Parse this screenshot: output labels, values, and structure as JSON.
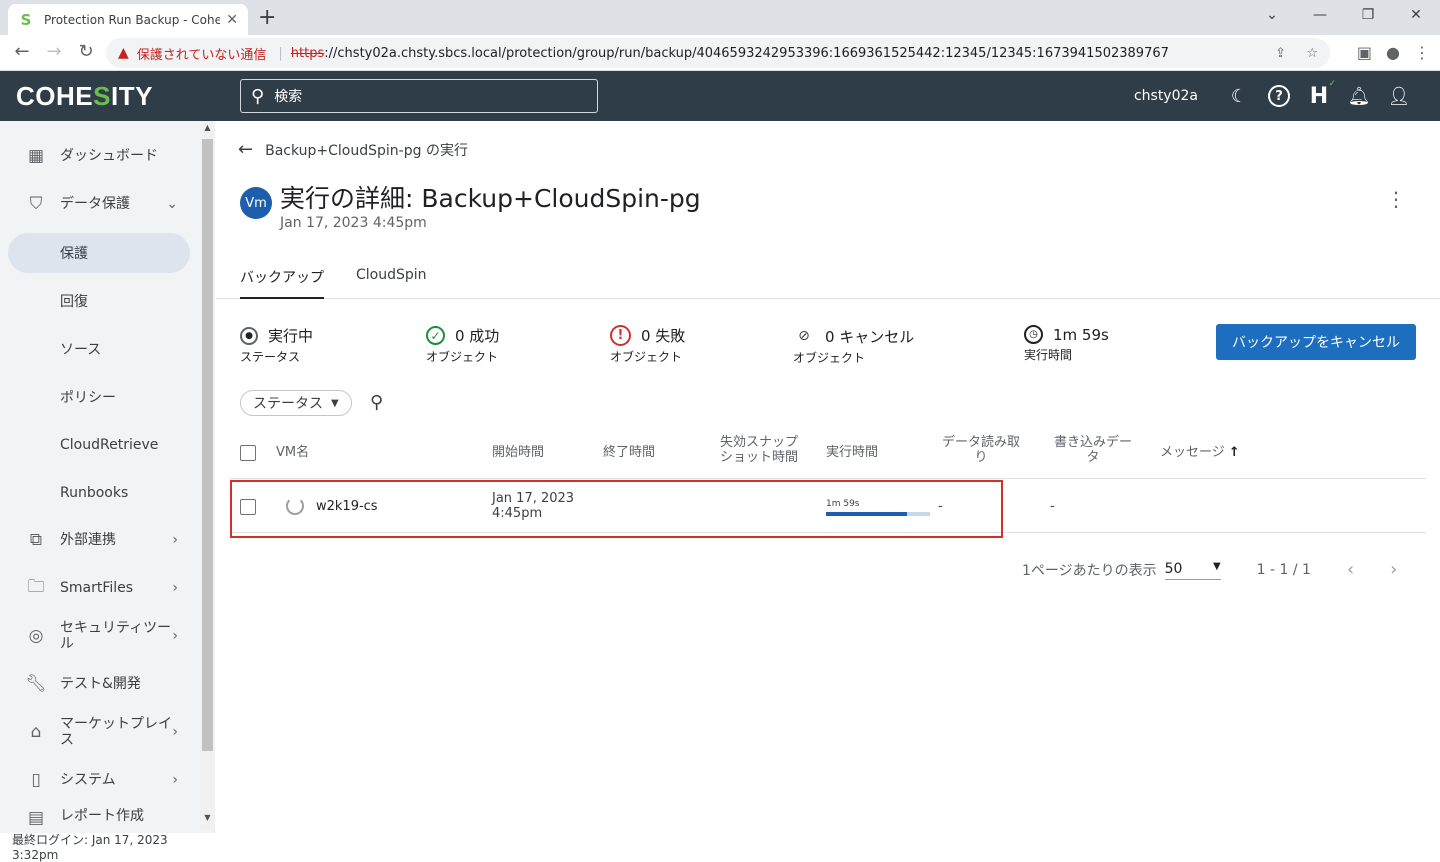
{
  "browser": {
    "tab_title": "Protection Run Backup - Cohesity",
    "new_tab": "+",
    "insecure_label": "保護されていない通信",
    "url_scheme": "https",
    "url_rest": "://chsty02a.chsty.sbcs.local/protection/group/run/backup/4046593242953396:1669361525442:12345/12345:1673941502389767"
  },
  "header": {
    "logo_left": "COHE",
    "logo_i": "S",
    "logo_right": "ITY",
    "search_placeholder": "検索",
    "user": "chsty02a"
  },
  "sidebar": {
    "items": [
      {
        "label": "ダッシュボード"
      },
      {
        "label": "データ保護"
      },
      {
        "label": "保護"
      },
      {
        "label": "回復"
      },
      {
        "label": "ソース"
      },
      {
        "label": "ポリシー"
      },
      {
        "label": "CloudRetrieve"
      },
      {
        "label": "Runbooks"
      },
      {
        "label": "外部連携"
      },
      {
        "label": "SmartFiles"
      },
      {
        "label": "セキュリティツール"
      },
      {
        "label": "テスト&開発"
      },
      {
        "label": "マーケットプレイス"
      },
      {
        "label": "システム"
      },
      {
        "label": "レポート作成"
      }
    ],
    "last_login": "最終ログイン: Jan 17, 2023 3:32pm"
  },
  "page": {
    "breadcrumb": "Backup+CloudSpin-pg の実行",
    "avatar": "Vm",
    "title": "実行の詳細: Backup+CloudSpin-pg",
    "subtitle": "Jan 17, 2023 4:45pm",
    "tabs": [
      {
        "label": "バックアップ"
      },
      {
        "label": "CloudSpin"
      }
    ],
    "stats": [
      {
        "value": "実行中",
        "label": "ステータス"
      },
      {
        "value": "0 成功",
        "label": "オブジェクト"
      },
      {
        "value": "0 失敗",
        "label": "オブジェクト"
      },
      {
        "value": "0 キャンセル",
        "label": "オブジェクト"
      },
      {
        "value": "1m 59s",
        "label": "実行時間"
      }
    ],
    "cancel_button": "バックアップをキャンセル",
    "filter_status": "ステータス"
  },
  "table": {
    "columns": [
      "VM名",
      "開始時間",
      "終了時間",
      "失効スナップショット時間",
      "実行時間",
      "データ読み取り",
      "書き込みデータ",
      "メッセージ"
    ],
    "rows": [
      {
        "name": "w2k19-cs",
        "start_date": "Jan 17, 2023",
        "start_time": "4:45pm",
        "end": "",
        "expiry": "",
        "duration": "1m 59s",
        "progress": 0.78,
        "data_read": "-",
        "data_written": "-"
      }
    ]
  },
  "pager": {
    "per_page_label": "1ページあたりの表示",
    "per_page": "50",
    "range": "1 - 1 / 1"
  }
}
